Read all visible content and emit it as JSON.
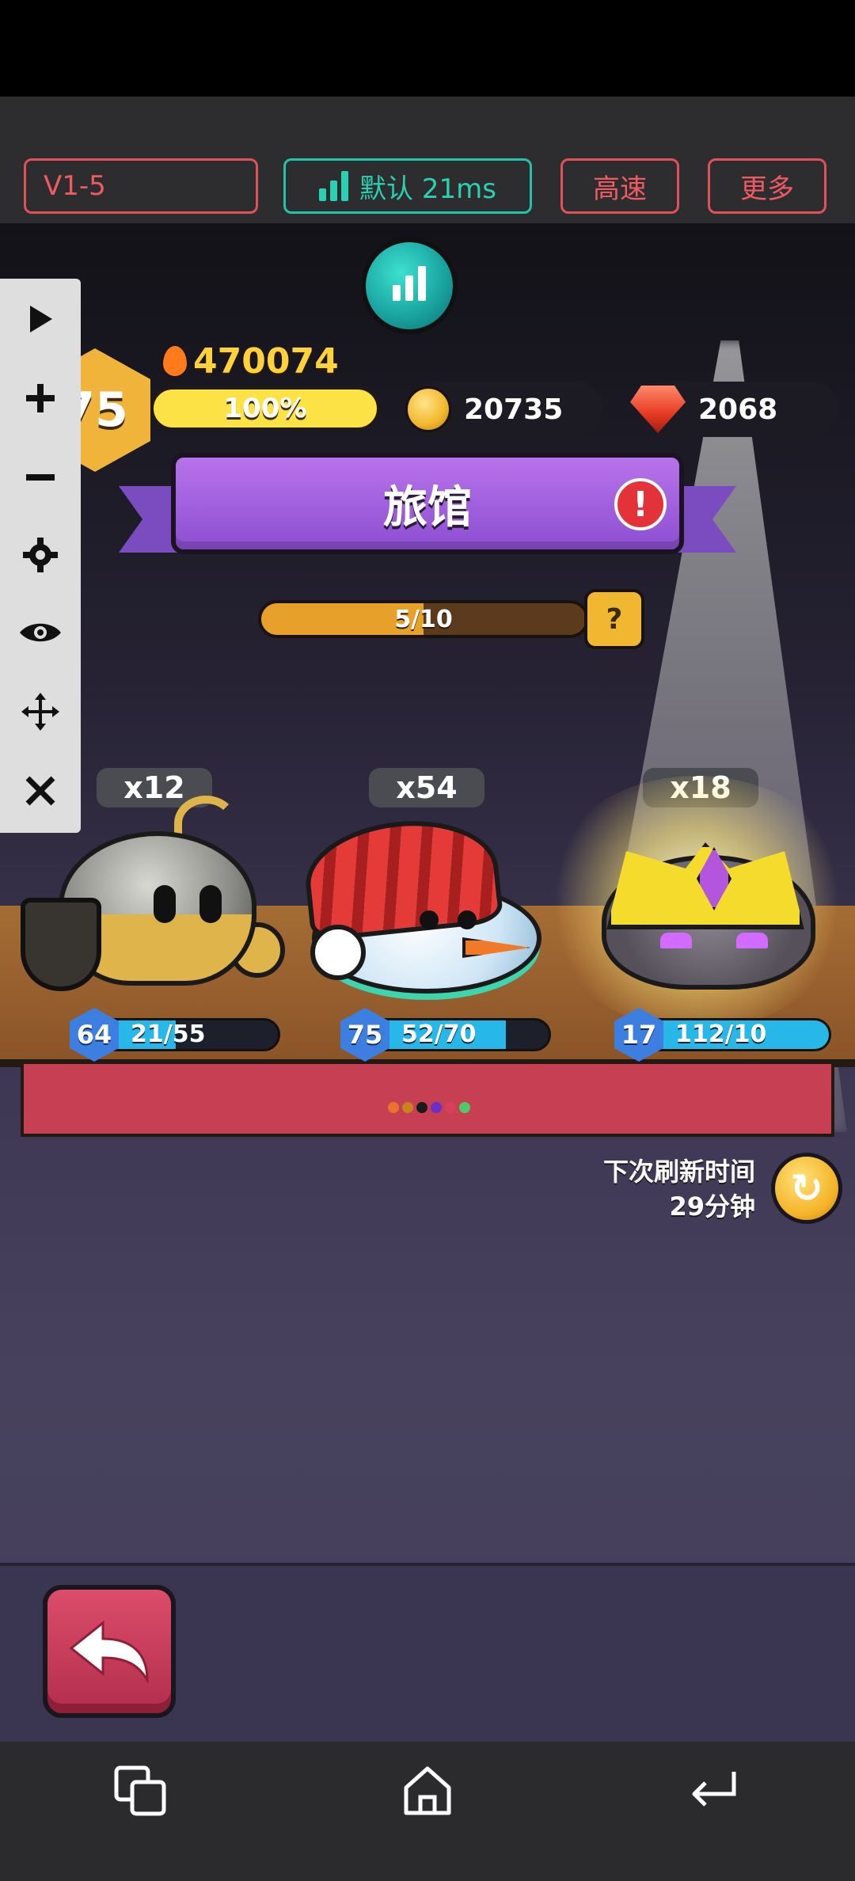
{
  "toolbar": {
    "version_label": "V1-5",
    "network_label": "默认 21ms",
    "speed_label": "高速",
    "more_label": "更多",
    "border_color": "#e0515a",
    "network_color": "#22c3a7"
  },
  "side_panel": {
    "icons": [
      "play-icon",
      "plus-icon",
      "minus-icon",
      "gear-icon",
      "eye-icon",
      "move-icon",
      "close-icon"
    ]
  },
  "hud": {
    "level": "75",
    "power": "470074",
    "xp_percent": "100%",
    "coins": "20735",
    "gems": "2068"
  },
  "banner": {
    "title": "旅馆",
    "alert_symbol": "!"
  },
  "progress": {
    "text": "5/10",
    "fraction": 0.5,
    "help_symbol": "?"
  },
  "creatures": [
    {
      "count": "x12",
      "level": "64",
      "hp": "21/55",
      "hp_fraction": 0.38
    },
    {
      "count": "x54",
      "level": "75",
      "hp": "52/70",
      "hp_fraction": 0.74
    },
    {
      "count": "x18",
      "level": "17",
      "hp": "112/10",
      "hp_fraction": 1.0
    }
  ],
  "page_dots": [
    "#e8742a",
    "#c8831f",
    "#1b1b1b",
    "#6a2fc4",
    "#d6405a",
    "#4fc96a"
  ],
  "refresh": {
    "label": "下次刷新时间",
    "time": "29分钟"
  },
  "colors": {
    "banner_purple": "#9b5de5",
    "gold": "#f2b730",
    "back_button": "#c8375a"
  }
}
